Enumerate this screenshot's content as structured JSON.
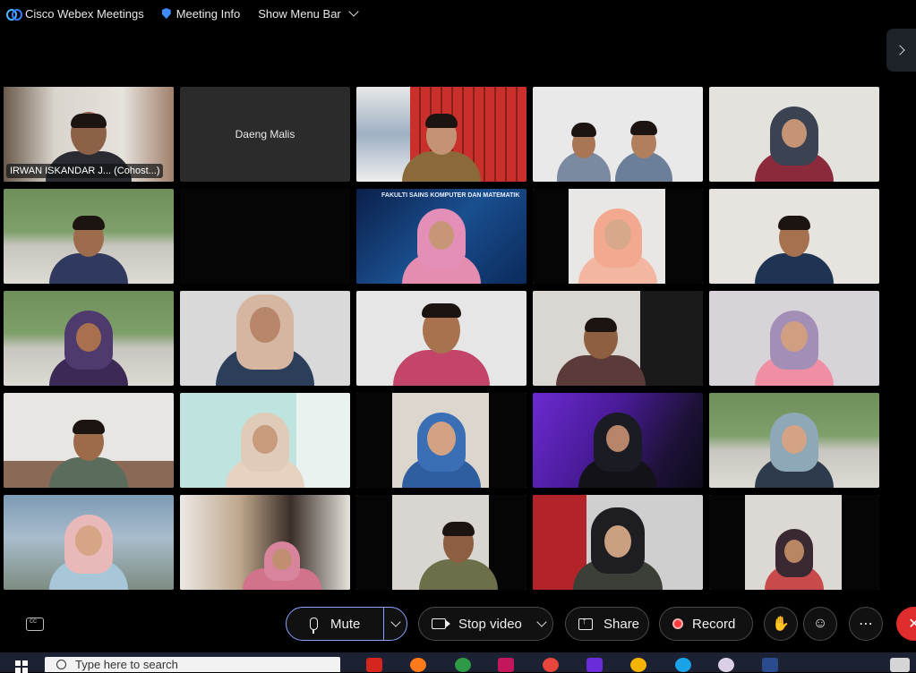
{
  "menubar": {
    "app_title": "Cisco Webex Meetings",
    "meeting_info": "Meeting Info",
    "show_menu_bar": "Show Menu Bar"
  },
  "participants": [
    {
      "label": "IRWAN ISKANDAR J... (Cohost...)"
    },
    {
      "name_only": "Daeng Malis"
    },
    {},
    {},
    {},
    {},
    {},
    {},
    {},
    {},
    {},
    {},
    {},
    {},
    {},
    {},
    {},
    {},
    {},
    {},
    {},
    {},
    {},
    {},
    {}
  ],
  "slide_banner": "FAKULTI SAINS KOMPUTER DAN MATEMATIK",
  "controls": {
    "mute": "Mute",
    "stop_video": "Stop video",
    "share": "Share",
    "record": "Record"
  },
  "taskbar": {
    "search_placeholder": "Type here to search"
  },
  "colors": {
    "accent": "#8aa0ff",
    "record": "#ff3b3b",
    "end": "#e02c2c"
  }
}
